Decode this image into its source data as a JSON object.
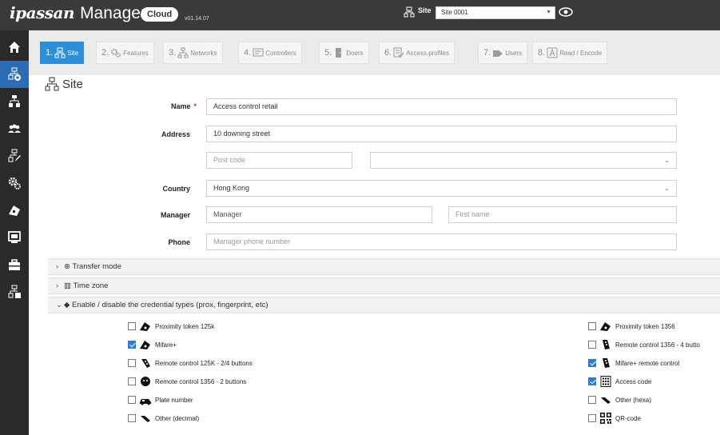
{
  "header": {
    "brand_ip": "ipassan",
    "brand_manager": "Manager",
    "cloud_badge": "Cloud",
    "version": "v01.14.07",
    "site_label": "Site",
    "site_value": "Site 0001"
  },
  "sidebar": {
    "items": [
      "home-icon",
      "add-site-icon",
      "sites-icon",
      "users-icon",
      "edit-site-icon",
      "features-icon",
      "access-card-icon",
      "monitor-icon",
      "toolbox-icon",
      "site-admin-icon"
    ]
  },
  "tabs": [
    {
      "num": "1.",
      "label": "Site",
      "icon": "site-icon",
      "active": true
    },
    {
      "num": "2.",
      "label": "Features",
      "icon": "gears-icon",
      "active": false
    },
    {
      "num": "3.",
      "label": "Networks",
      "icon": "network-icon",
      "active": false
    },
    {
      "num": "4.",
      "label": "Controllers",
      "icon": "controller-icon",
      "active": false
    },
    {
      "num": "5.",
      "label": "Doors",
      "icon": "door-icon",
      "active": false
    },
    {
      "num": "6.",
      "label": "Access profiles",
      "icon": "access-profile-icon",
      "active": false
    },
    {
      "num": "7.",
      "label": "Users",
      "icon": "users-icon",
      "active": false
    },
    {
      "num": "8.",
      "label": "Read / Encode",
      "icon": "card-icon",
      "active": false
    }
  ],
  "section": {
    "title": "Site"
  },
  "form": {
    "name_label": "Name",
    "name_required": "*",
    "name_value": "Access control retail",
    "address_label": "Address",
    "address_value": "10 downing street",
    "postcode_placeholder": "Post code",
    "city_value": "",
    "country_label": "Country",
    "country_value": "Hong Kong",
    "manager_label": "Manager",
    "manager_placeholder": "Manager",
    "firstname_placeholder": "First name",
    "phone_label": "Phone",
    "phone_placeholder": "Manager phone number"
  },
  "accordions": {
    "transfer_mode": "Transfer mode",
    "time_zone": "Time zone",
    "credentials": "Enable / disable the credential types (prox, fingerprint, etc)"
  },
  "credentials": {
    "left": [
      {
        "label": "Proximity token 125k",
        "checked": false,
        "icon": "token-icon"
      },
      {
        "label": "Mifare+",
        "checked": true,
        "icon": "token-icon"
      },
      {
        "label": "Remote control 125K - 2/4 buttons",
        "checked": false,
        "icon": "remote-icon"
      },
      {
        "label": "Remote control 1356 - 2 buttons",
        "checked": false,
        "icon": "remote-icon"
      },
      {
        "label": "Plate number",
        "checked": false,
        "icon": "car-icon"
      },
      {
        "label": "Other (decimal)",
        "checked": false,
        "icon": "other-icon"
      }
    ],
    "right": [
      {
        "label": "Proximity token 1356",
        "checked": false,
        "icon": "token-icon"
      },
      {
        "label": "Remote control 1356 - 4 butto",
        "checked": false,
        "icon": "remote-icon"
      },
      {
        "label": "Mifare+ remote control",
        "checked": true,
        "icon": "remote-icon"
      },
      {
        "label": "Access code",
        "checked": true,
        "icon": "keypad-icon"
      },
      {
        "label": "Other (hexa)",
        "checked": false,
        "icon": "other-icon"
      },
      {
        "label": "QR-code",
        "checked": false,
        "icon": "qr-code-icon"
      }
    ]
  },
  "colors": {
    "accent": "#2b8fd9",
    "topbar": "#3a3a3a",
    "sidebar": "#2a2a2a",
    "sidebar_active": "#2b6cb3"
  }
}
